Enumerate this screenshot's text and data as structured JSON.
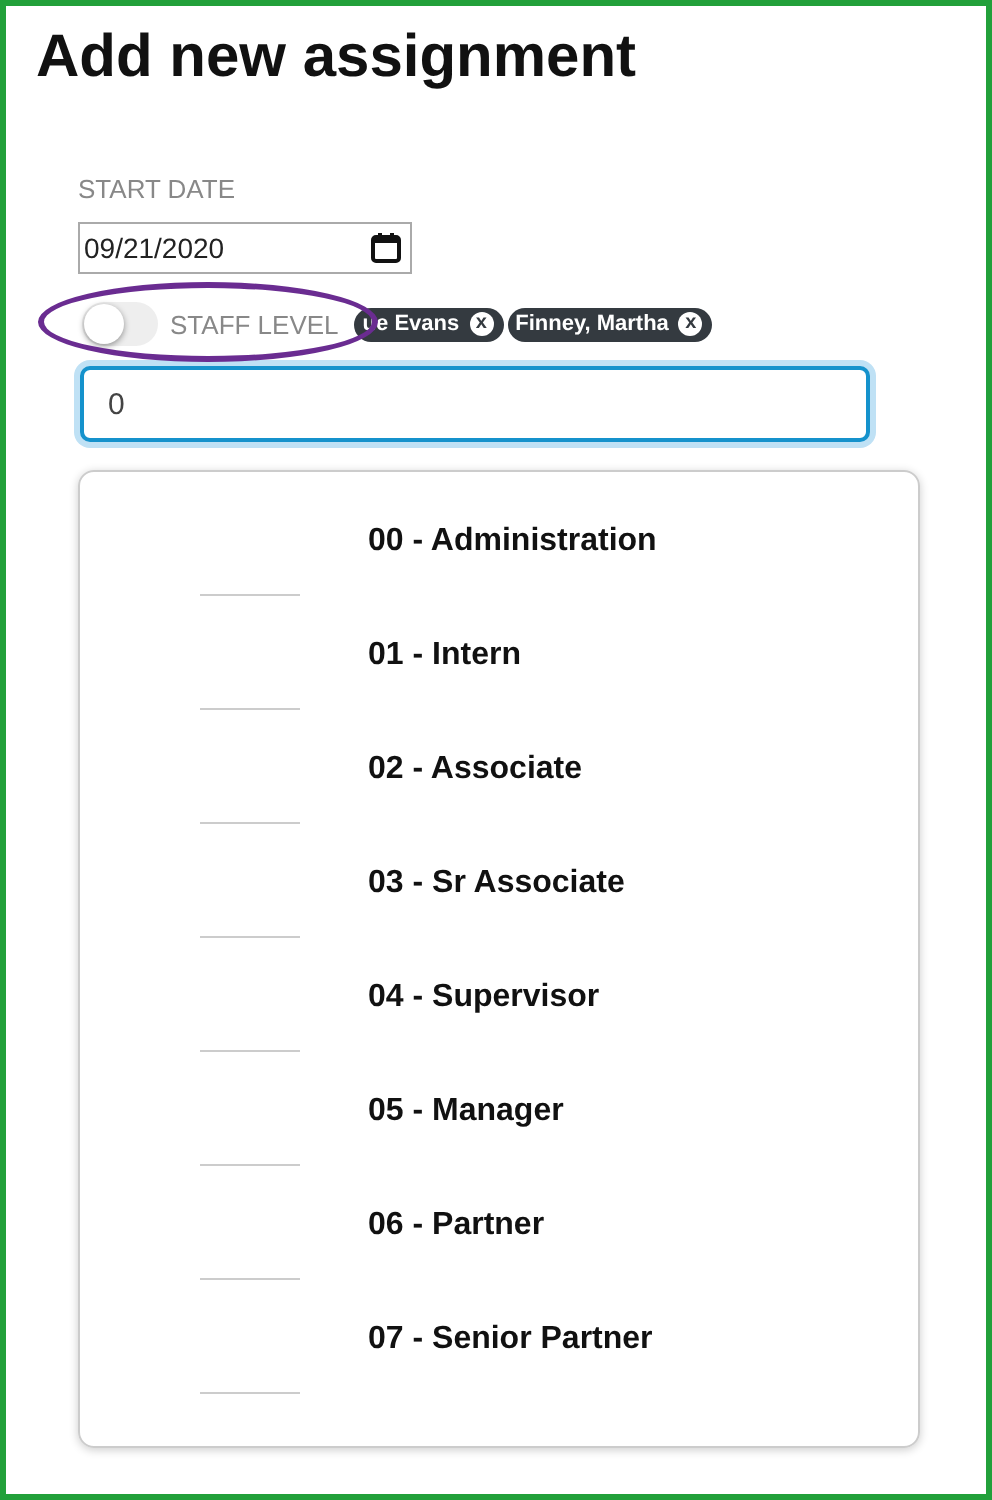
{
  "title": "Add new assignment",
  "start_date": {
    "label": "START DATE",
    "value": "09/21/2020"
  },
  "staff_level": {
    "label": "STAFF LEVEL",
    "on": false,
    "highlighted": true
  },
  "chips": [
    {
      "label": "ue Evans",
      "remove": "x"
    },
    {
      "label": "Finney, Martha",
      "remove": "x"
    }
  ],
  "search": {
    "value": "0"
  },
  "options": [
    {
      "label": "00 - Administration"
    },
    {
      "label": "01 - Intern"
    },
    {
      "label": "02 - Associate"
    },
    {
      "label": "03 - Sr Associate"
    },
    {
      "label": "04 - Supervisor"
    },
    {
      "label": "05 - Manager"
    },
    {
      "label": "06 - Partner"
    },
    {
      "label": "07 - Senior Partner"
    }
  ]
}
